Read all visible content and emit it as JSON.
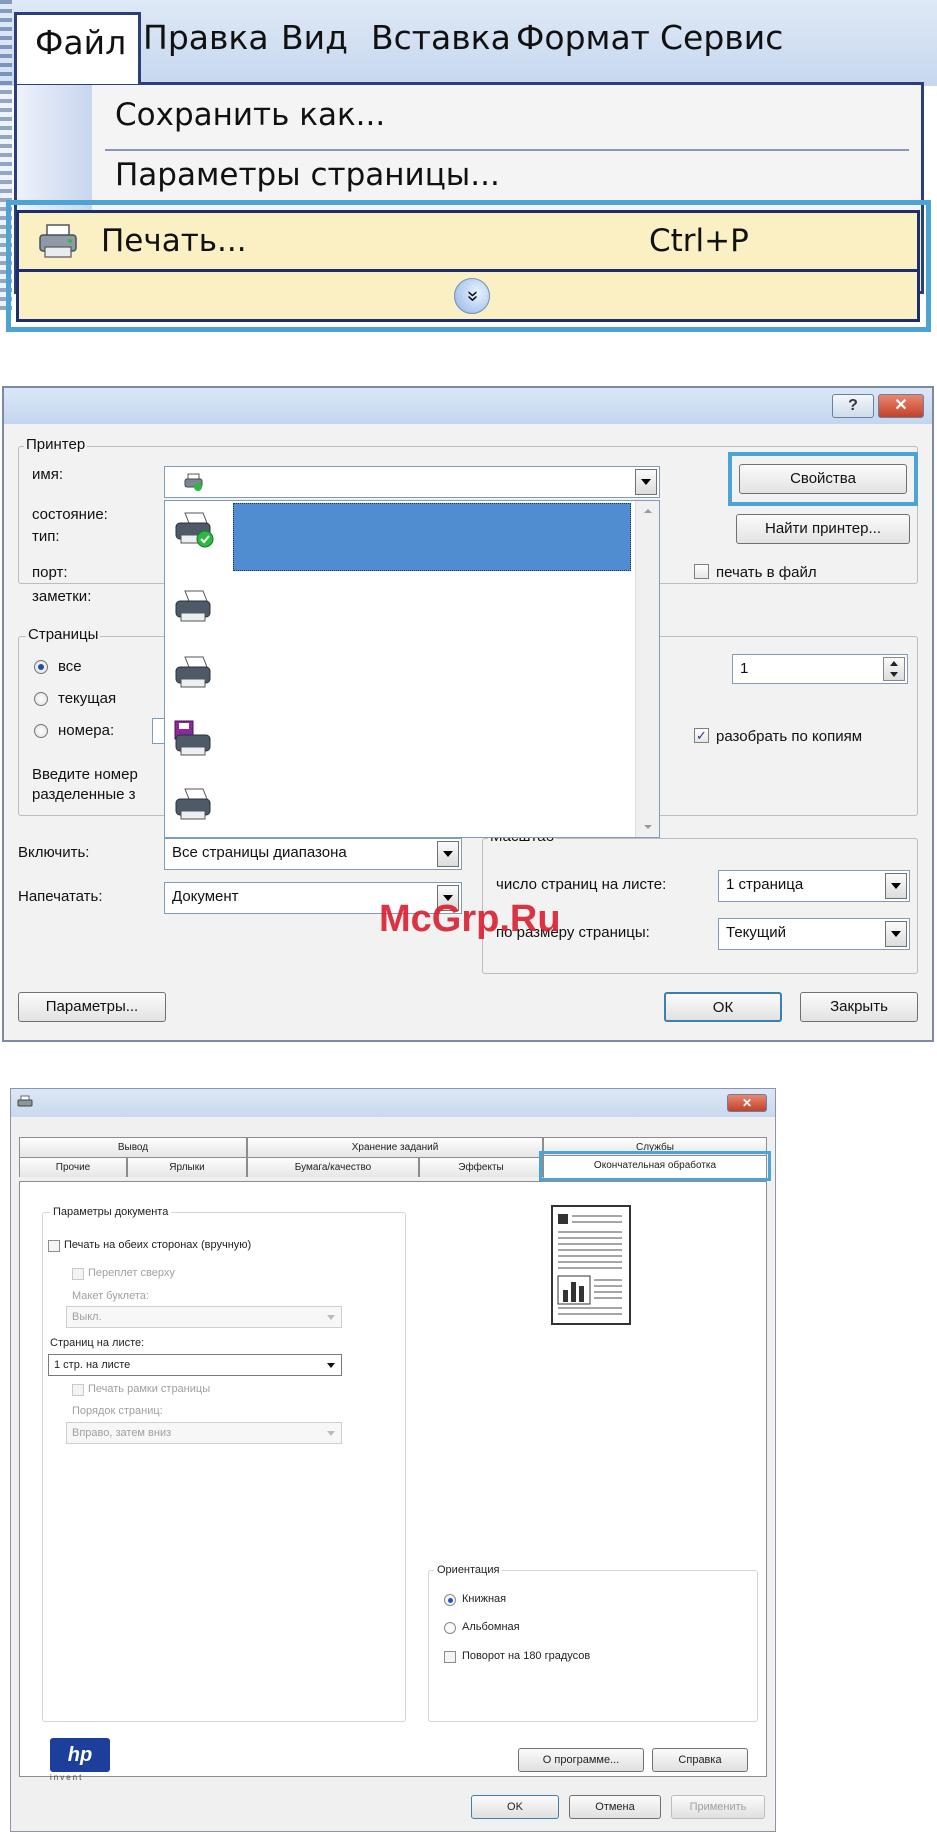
{
  "menu": {
    "items": [
      {
        "label": "Файл"
      },
      {
        "label": "Правка"
      },
      {
        "label": "Вид"
      },
      {
        "label": "Вставка"
      },
      {
        "label": "Формат"
      },
      {
        "label": "Сервис"
      }
    ],
    "dropdown": {
      "save_as": "Сохранить как...",
      "page_setup": "Параметры страницы...",
      "print": "Печать...",
      "print_shortcut": "Ctrl+P",
      "expand_glyph": "»"
    }
  },
  "print_dialog": {
    "title_buttons": {
      "help": "?",
      "close": "✕"
    },
    "printer_group": "Принтер",
    "labels": {
      "name": "имя:",
      "status": "состояние:",
      "type": "тип:",
      "port": "порт:",
      "notes": "заметки:"
    },
    "properties_button": "Свойства",
    "find_printer_button": "Найти принтер...",
    "print_to_file": "печать в файл",
    "pages_group": "Страницы",
    "radio_all": "все",
    "radio_current": "текущая",
    "radio_numbers": "номера:",
    "hint_line1": "Введите номер",
    "hint_line2": "разделенные з",
    "copies_value": "1",
    "collate": "разобрать по копиям",
    "include_label": "Включить:",
    "include_value": "Все страницы диапазона",
    "print_what_label": "Напечатать:",
    "print_what_value": "Документ",
    "scale_group": "Масштаб",
    "pages_per_sheet_label": "число страниц на листе:",
    "pages_per_sheet_value": "1 страница",
    "fit_label": "по размеру страницы:",
    "fit_value": "Текущий",
    "options_button": "Параметры...",
    "ok_button": "ОК",
    "close_button": "Закрыть",
    "watermark": "McGrp.Ru"
  },
  "props_dialog": {
    "tabs_row1": [
      "Вывод",
      "Хранение заданий",
      "Службы"
    ],
    "tabs_row2": [
      "Прочие",
      "Ярлыки",
      "Бумага/качество",
      "Эффекты",
      "Окончательная обработка"
    ],
    "doc_params_group": "Параметры документа",
    "both_sides": "Печать на обеих сторонах (вручную)",
    "flip_up": "Переплет сверху",
    "booklet_layout": "Макет буклета:",
    "booklet_value": "Выкл.",
    "pages_per_sheet": "Страниц на листе:",
    "pages_per_sheet_value": "1 стр. на листе",
    "print_borders": "Печать рамки страницы",
    "page_order": "Порядок страниц:",
    "page_order_value": "Вправо, затем вниз",
    "orientation_group": "Ориентация",
    "portrait": "Книжная",
    "landscape": "Альбомная",
    "rotate": "Поворот на 180 градусов",
    "about_button": "О программе...",
    "help_button": "Справка",
    "ok_button": "OK",
    "cancel_button": "Отмена",
    "apply_button": "Применить",
    "logo_text": "hp",
    "logo_tagline": "invent"
  },
  "colors": {
    "highlight": "#4ca3d5",
    "menu_select": "#fbefc4",
    "list_select": "#4f8cd0",
    "watermark": "#d91f2e"
  }
}
